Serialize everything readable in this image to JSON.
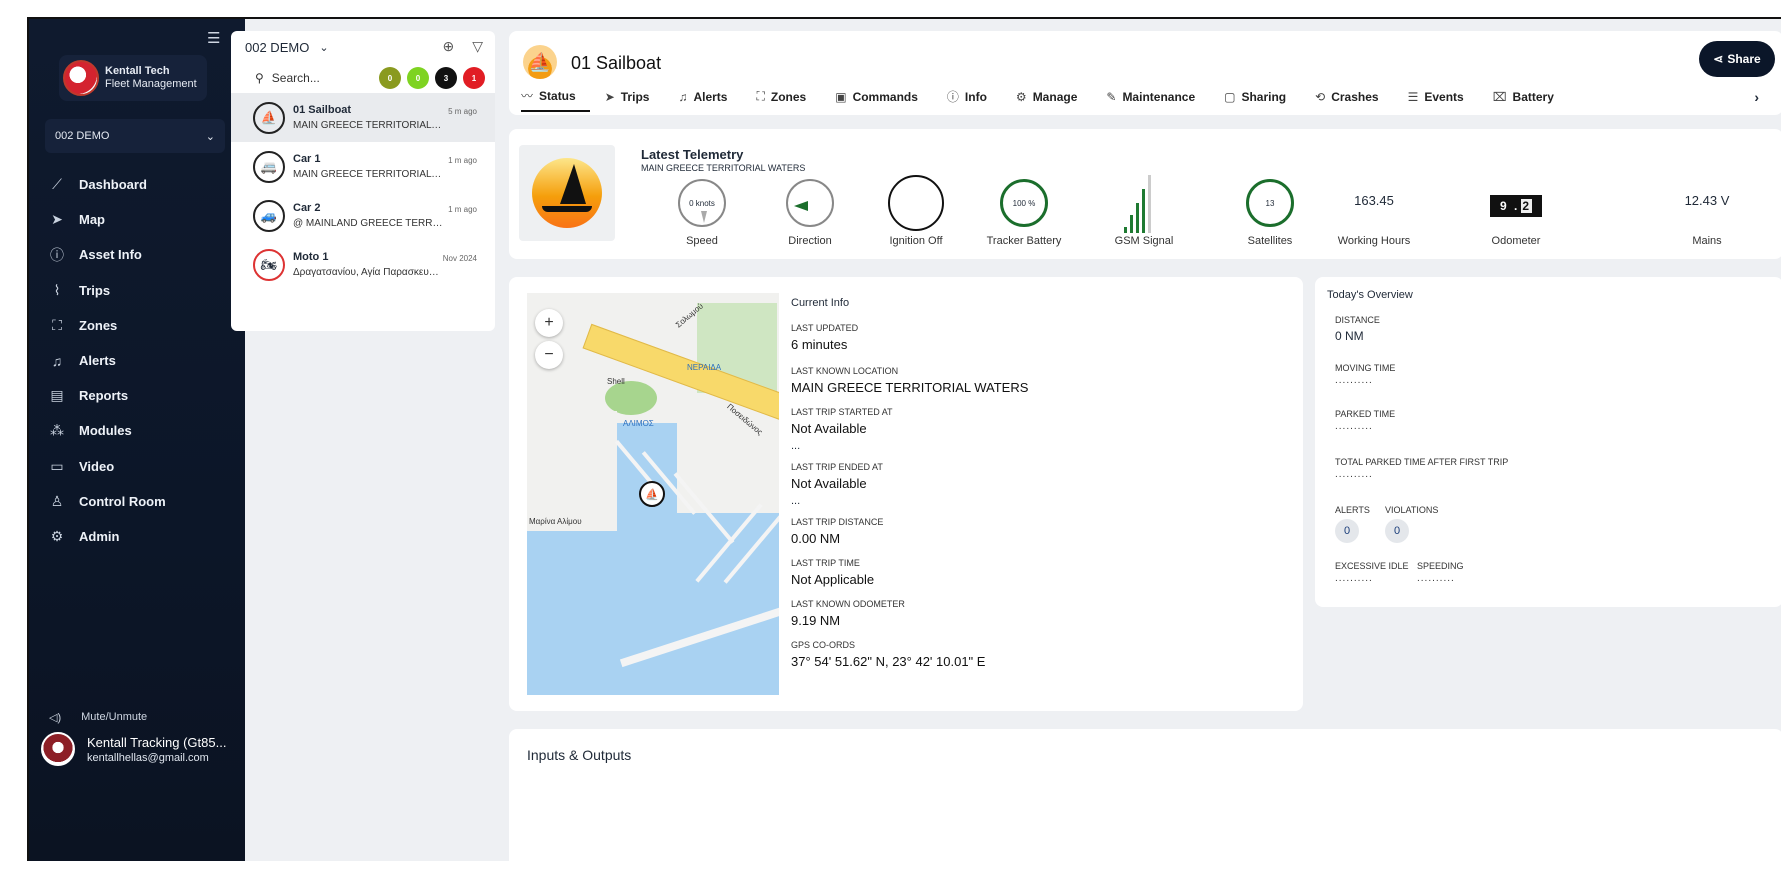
{
  "sidebar": {
    "brand_name": "Kentall Tech",
    "brand_sub": "Fleet Management",
    "fleet": "002 DEMO",
    "items": [
      {
        "label": "Dashboard",
        "icon": "chart-icon"
      },
      {
        "label": "Map",
        "icon": "navigation-icon"
      },
      {
        "label": "Asset Info",
        "icon": "info-icon"
      },
      {
        "label": "Trips",
        "icon": "route-icon"
      },
      {
        "label": "Zones",
        "icon": "zone-icon"
      },
      {
        "label": "Alerts",
        "icon": "bell-icon"
      },
      {
        "label": "Reports",
        "icon": "report-icon"
      },
      {
        "label": "Modules",
        "icon": "modules-icon"
      },
      {
        "label": "Video",
        "icon": "video-icon"
      },
      {
        "label": "Control Room",
        "icon": "control-room-icon"
      },
      {
        "label": "Admin",
        "icon": "gear-icon"
      }
    ],
    "mute_label": "Mute/Unmute",
    "user_name": "Kentall Tracking (Gt85...",
    "user_email": "kentallhellas@gmail.com"
  },
  "assets": {
    "group": "002 DEMO",
    "search_placeholder": "Search...",
    "badges": [
      {
        "value": "0",
        "color": "#8a9a1f"
      },
      {
        "value": "0",
        "color": "#7ed321"
      },
      {
        "value": "3",
        "color": "#111111"
      },
      {
        "value": "1",
        "color": "#e11d24"
      }
    ],
    "list": [
      {
        "name": "01 Sailboat",
        "location": "MAIN GREECE TERRITORIAL WAT...",
        "time": "5 m ago"
      },
      {
        "name": "Car 1",
        "location": "MAIN GREECE TERRITORIAL WAT...",
        "time": "1 m ago"
      },
      {
        "name": "Car 2",
        "location": "@ MAINLAND GREECE TERRITORI...",
        "time": "1 m ago"
      },
      {
        "name": "Moto 1",
        "location": "Δραγατσανίου, Αγία Παρασκευή, Ε...",
        "time": "Nov 2024"
      }
    ]
  },
  "header": {
    "title": "01 Sailboat",
    "share": "Share",
    "tabs": [
      "Status",
      "Trips",
      "Alerts",
      "Zones",
      "Commands",
      "Info",
      "Manage",
      "Maintenance",
      "Sharing",
      "Crashes",
      "Events",
      "Battery"
    ],
    "next": "›"
  },
  "telemetry": {
    "title": "Latest Telemetry",
    "location": "MAIN GREECE TERRITORIAL WATERS",
    "speed_value": "0 knots",
    "speed_label": "Speed",
    "direction_label": "Direction",
    "ignition_label": "Ignition Off",
    "battery_value": "100 %",
    "battery_label": "Tracker Battery",
    "gsm_label": "GSM Signal",
    "satellites_value": "13",
    "satellites_label": "Satellites",
    "hours_value": "163.45",
    "hours_label": "Working Hours",
    "odometer_int": "9 .",
    "odometer_dec": "2",
    "odometer_label": "Odometer",
    "mains_value": "12.43 V",
    "mains_label": "Mains"
  },
  "map": {
    "zoom_in": "+",
    "zoom_out": "−",
    "labels": {
      "shell": "Shell",
      "neraida": "ΝΕΡΑΙΔΑ",
      "alimos": "ΑΛΙΜΟΣ",
      "marina": "Μαρίνα Αλίμου",
      "solomou": "Σολωμού",
      "poseidonos": "Ποσειδώνος"
    }
  },
  "current_info": {
    "title": "Current Info",
    "fields": [
      {
        "label": "LAST UPDATED",
        "value": "6 minutes"
      },
      {
        "label": "LAST KNOWN LOCATION",
        "value": "MAIN GREECE TERRITORIAL WATERS"
      },
      {
        "label": "LAST TRIP STARTED AT",
        "value": "Not Available",
        "extra": "..."
      },
      {
        "label": "LAST TRIP ENDED AT",
        "value": "Not Available",
        "extra": "..."
      },
      {
        "label": "LAST TRIP DISTANCE",
        "value": "0.00 NM"
      },
      {
        "label": "LAST TRIP TIME",
        "value": "Not Applicable"
      },
      {
        "label": "LAST KNOWN ODOMETER",
        "value": "9.19 NM"
      },
      {
        "label": "GPS CO-ORDS",
        "value": "37° 54' 51.62\" N, 23° 42' 10.01\" E"
      }
    ]
  },
  "overview": {
    "title": "Today's Overview",
    "distance_label": "DISTANCE",
    "distance_value": "0 NM",
    "moving_label": "MOVING TIME",
    "moving_value": "..........",
    "parked_label": "PARKED TIME",
    "parked_value": "..........",
    "total_parked_label": "TOTAL PARKED TIME AFTER FIRST TRIP",
    "total_parked_value": "..........",
    "alerts_label": "ALERTS",
    "alerts_value": "0",
    "violations_label": "VIOLATIONS",
    "violations_value": "0",
    "idle_label": "EXCESSIVE IDLE",
    "idle_value": "..........",
    "speeding_label": "SPEEDING",
    "speeding_value": ".........."
  },
  "io": {
    "title": "Inputs & Outputs"
  }
}
